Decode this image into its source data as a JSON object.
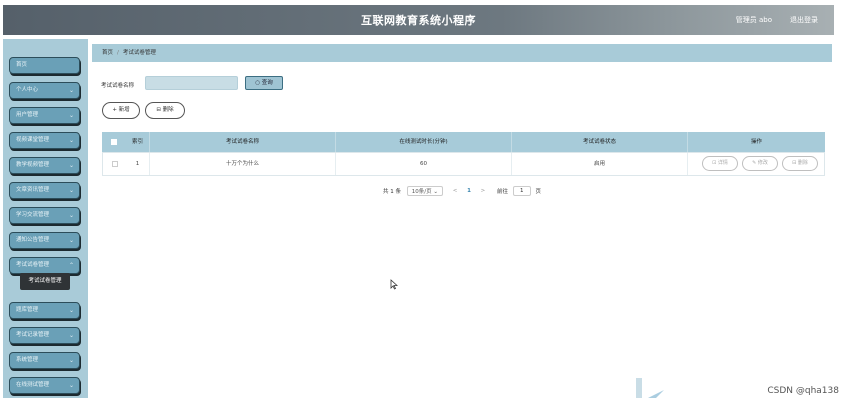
{
  "header": {
    "title": "互联网教育系统小程序",
    "user_label": "管理员 abo",
    "logout_label": "退出登录"
  },
  "sidebar": {
    "items": [
      {
        "label": "首页",
        "has_children": false
      },
      {
        "label": "个人中心",
        "has_children": true
      },
      {
        "label": "用户管理",
        "has_children": true
      },
      {
        "label": "视频课堂管理",
        "has_children": true
      },
      {
        "label": "教学视频管理",
        "has_children": true
      },
      {
        "label": "文章资讯管理",
        "has_children": true
      },
      {
        "label": "学习交流管理",
        "has_children": true
      },
      {
        "label": "通知公告管理",
        "has_children": true
      },
      {
        "label": "考试试卷管理",
        "has_children": true
      },
      {
        "label": "题库管理",
        "has_children": true
      },
      {
        "label": "考试记录管理",
        "has_children": true
      },
      {
        "label": "系统管理",
        "has_children": true
      },
      {
        "label": "在线测试管理",
        "has_children": true
      }
    ],
    "active_sub": "考试试卷管理"
  },
  "breadcrumb": {
    "home": "首页",
    "current": "考试试卷管理"
  },
  "search": {
    "label": "考试试卷名称",
    "value": "",
    "placeholder": "",
    "button": "查询"
  },
  "actions": {
    "add": "+ 新增",
    "delete": "删除"
  },
  "table": {
    "headers": [
      "索引",
      "考试试卷名称",
      "在线测试时长(分钟)",
      "考试试卷状态",
      "操作"
    ],
    "rows": [
      {
        "index": "1",
        "name": "十万个为什么",
        "duration": "60",
        "status": "启用"
      }
    ],
    "row_actions": [
      "详情",
      "修改",
      "删除"
    ]
  },
  "pagination": {
    "total": "共 1 条",
    "page_size": "10条/页",
    "prev": "<",
    "current": "1",
    "next": ">",
    "goto_label": "前往",
    "goto_value": "1",
    "page_unit": "页"
  },
  "watermark": "CSDN @qha138",
  "colors": {
    "sidebar_bg": "#a9cbd8",
    "menu_item": "#6aa0b7",
    "table_header": "#a7cbd9",
    "breadcrumb_bg": "#a8cbd8"
  }
}
